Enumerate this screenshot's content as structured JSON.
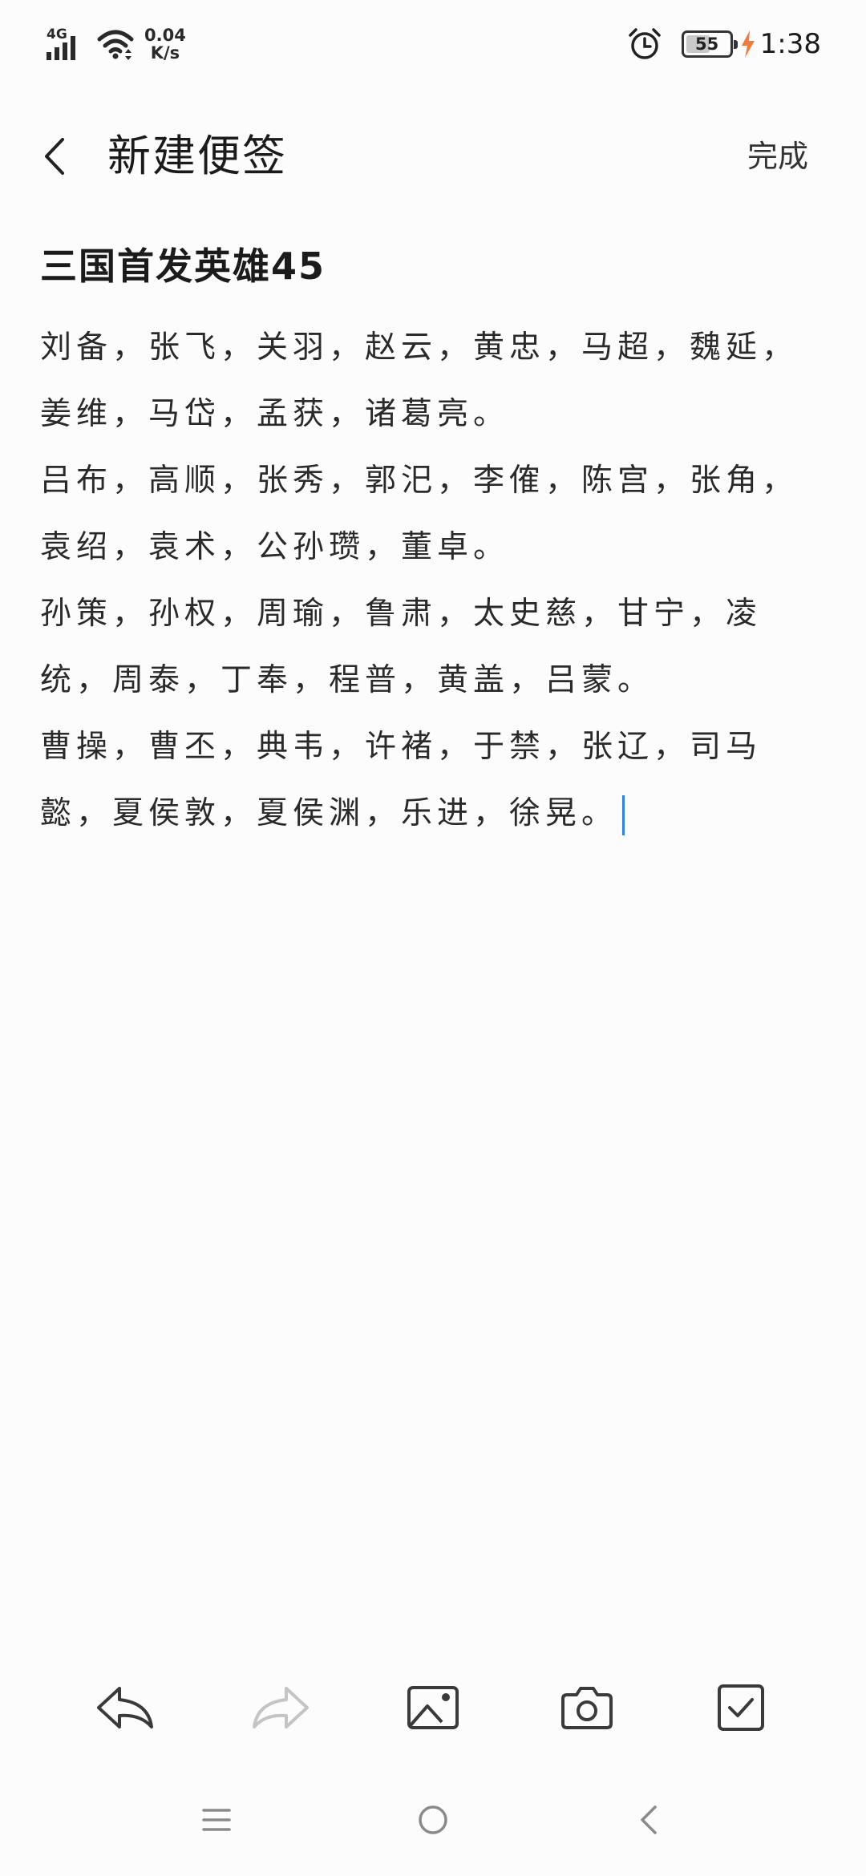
{
  "status_bar": {
    "network": "4G",
    "speed_value": "0.04",
    "speed_unit": "K/s",
    "battery_level": "55",
    "battery_fraction": 0.55,
    "time": "1:38"
  },
  "header": {
    "title": "新建便签",
    "done_label": "完成"
  },
  "note": {
    "title": "三国首发英雄45",
    "lines": [
      "刘备，张飞，关羽，赵云，黄忠，马超，魏延，",
      "姜维，马岱，孟获，诸葛亮。",
      "吕布，高顺，张秀，郭汜，李傕，陈宫，张角，",
      "袁绍，袁术，公孙瓒，董卓。",
      "孙策，孙权，周瑜，鲁肃，太史慈，甘宁，凌",
      "统，周泰，丁奉，程普，黄盖，吕蒙。",
      "曹操，曹丕，典韦，许褚，于禁，张辽，司马",
      "懿，夏侯敦，夏侯渊，乐进，徐晃。"
    ]
  },
  "toolbar": {
    "icons": [
      "undo-icon",
      "redo-icon",
      "image-icon",
      "camera-icon",
      "checkbox-icon"
    ],
    "redo_enabled": false
  },
  "navbar": {
    "icons": [
      "menu-icon",
      "home-icon",
      "back-icon"
    ]
  },
  "colors": {
    "background": "#fcfcfc",
    "text": "#1b1b1b",
    "cursor": "#2f7fe8",
    "charge": "#f07c3c",
    "disabled_icon": "#c4c4c4"
  }
}
